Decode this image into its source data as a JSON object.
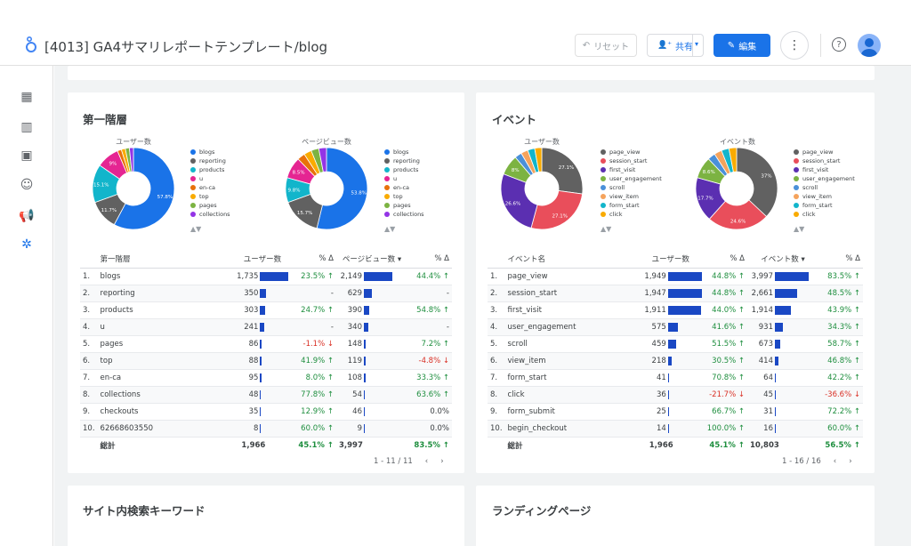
{
  "header": {
    "title": "[4013] GA4サマリレポートテンプレート/blog",
    "reset_label": "リセット",
    "share_label": "共有",
    "edit_label": "編集",
    "more_icon": "more-vert-icon",
    "help_icon": "help-icon"
  },
  "colors": {
    "accent": "#1a73e8",
    "bar": "#1a48c4"
  },
  "sidebar": {
    "icons": [
      "dashboard-icon",
      "bar-chart-icon",
      "calendar-icon",
      "face-icon",
      "campaign-icon",
      "hub-icon"
    ],
    "expand": "›"
  },
  "left_card": {
    "title": "第一階層",
    "donut1_label": "ユーザー数",
    "donut2_label": "ページビュー数",
    "legend": [
      "blogs",
      "reporting",
      "products",
      "u",
      "en-ca",
      "top",
      "pages",
      "collections"
    ],
    "legend_colors": [
      "#1a73e8",
      "#616161",
      "#12b5cb",
      "#e52592",
      "#e8710a",
      "#f9ab00",
      "#7cb342",
      "#9334e6"
    ],
    "donut1_pcts": [
      "57.8%",
      "11.7%",
      "15.1%",
      "9%"
    ],
    "donut2_pcts": [
      "53.8%",
      "15.7%",
      "9.8%",
      "8.5%"
    ],
    "nav": "▲▼",
    "table": {
      "headers": [
        "第一階層",
        "ユーザー数",
        "% Δ",
        "ページビュー数 ▾",
        "% Δ"
      ],
      "rows": [
        [
          "1.",
          "blogs",
          "1,735",
          "23.5% ↑",
          "2,149",
          "44.4% ↑"
        ],
        [
          "2.",
          "reporting",
          "350",
          "-",
          "629",
          "-"
        ],
        [
          "3.",
          "products",
          "303",
          "24.7% ↑",
          "390",
          "54.8% ↑"
        ],
        [
          "4.",
          "u",
          "241",
          "-",
          "340",
          "-"
        ],
        [
          "5.",
          "pages",
          "86",
          "-1.1% ↓",
          "148",
          "7.2% ↑"
        ],
        [
          "6.",
          "top",
          "88",
          "41.9% ↑",
          "119",
          "-4.8% ↓"
        ],
        [
          "7.",
          "en-ca",
          "95",
          "8.0% ↑",
          "108",
          "33.3% ↑"
        ],
        [
          "8.",
          "collections",
          "48",
          "77.8% ↑",
          "54",
          "63.6% ↑"
        ],
        [
          "9.",
          "checkouts",
          "35",
          "12.9% ↑",
          "46",
          "0.0%"
        ],
        [
          "10.",
          "62668603550",
          "8",
          "60.0% ↑",
          "9",
          "0.0%"
        ]
      ],
      "bar_fracs1": [
        1,
        0.2,
        0.17,
        0.14,
        0.05,
        0.05,
        0.055,
        0.028,
        0.02,
        0.005
      ],
      "bar_fracs2": [
        1,
        0.29,
        0.18,
        0.16,
        0.07,
        0.055,
        0.05,
        0.025,
        0.021,
        0.004
      ],
      "total": [
        "",
        "総計",
        "1,966",
        "45.1% ↑",
        "3,997",
        "83.5% ↑"
      ],
      "pager": "1 - 11 / 11"
    }
  },
  "right_card": {
    "title": "イベント",
    "donut1_label": "ユーザー数",
    "donut2_label": "イベント数",
    "legend": [
      "page_view",
      "session_start",
      "first_visit",
      "user_engagement",
      "scroll",
      "view_item",
      "form_start",
      "click"
    ],
    "legend_colors": [
      "#616161",
      "#e94e5b",
      "#5b2fb1",
      "#7cb342",
      "#4a90d9",
      "#f5a35c",
      "#12b5cb",
      "#f9ab00"
    ],
    "donut1_pcts": [
      "27.1%",
      "27.1%",
      "26.6%",
      "8%"
    ],
    "donut2_pcts": [
      "37%",
      "24.6%",
      "17.7%",
      "8.6%"
    ],
    "nav": "▲▼",
    "table": {
      "headers": [
        "イベント名",
        "ユーザー数",
        "% Δ",
        "イベント数 ▾",
        "% Δ"
      ],
      "rows": [
        [
          "1.",
          "page_view",
          "1,949",
          "44.8% ↑",
          "3,997",
          "83.5% ↑"
        ],
        [
          "2.",
          "session_start",
          "1,947",
          "44.8% ↑",
          "2,661",
          "48.5% ↑"
        ],
        [
          "3.",
          "first_visit",
          "1,911",
          "44.0% ↑",
          "1,914",
          "43.9% ↑"
        ],
        [
          "4.",
          "user_engagement",
          "575",
          "41.6% ↑",
          "931",
          "34.3% ↑"
        ],
        [
          "5.",
          "scroll",
          "459",
          "51.5% ↑",
          "673",
          "58.7% ↑"
        ],
        [
          "6.",
          "view_item",
          "218",
          "30.5% ↑",
          "414",
          "46.8% ↑"
        ],
        [
          "7.",
          "form_start",
          "41",
          "70.8% ↑",
          "64",
          "42.2% ↑"
        ],
        [
          "8.",
          "click",
          "36",
          "-21.7% ↓",
          "45",
          "-36.6% ↓"
        ],
        [
          "9.",
          "form_submit",
          "25",
          "66.7% ↑",
          "31",
          "72.2% ↑"
        ],
        [
          "10.",
          "begin_checkout",
          "14",
          "100.0% ↑",
          "16",
          "60.0% ↑"
        ]
      ],
      "bar_fracs1": [
        1,
        1,
        0.98,
        0.3,
        0.24,
        0.11,
        0.02,
        0.02,
        0.013,
        0.007
      ],
      "bar_fracs2": [
        1,
        0.67,
        0.48,
        0.23,
        0.17,
        0.1,
        0.016,
        0.011,
        0.008,
        0.004
      ],
      "total": [
        "",
        "総計",
        "1,966",
        "45.1% ↑",
        "10,803",
        "56.5% ↑"
      ],
      "pager": "1 - 16 / 16"
    }
  },
  "bottom_left_title": "サイト内検索キーワード",
  "bottom_right_title": "ランディングページ"
}
